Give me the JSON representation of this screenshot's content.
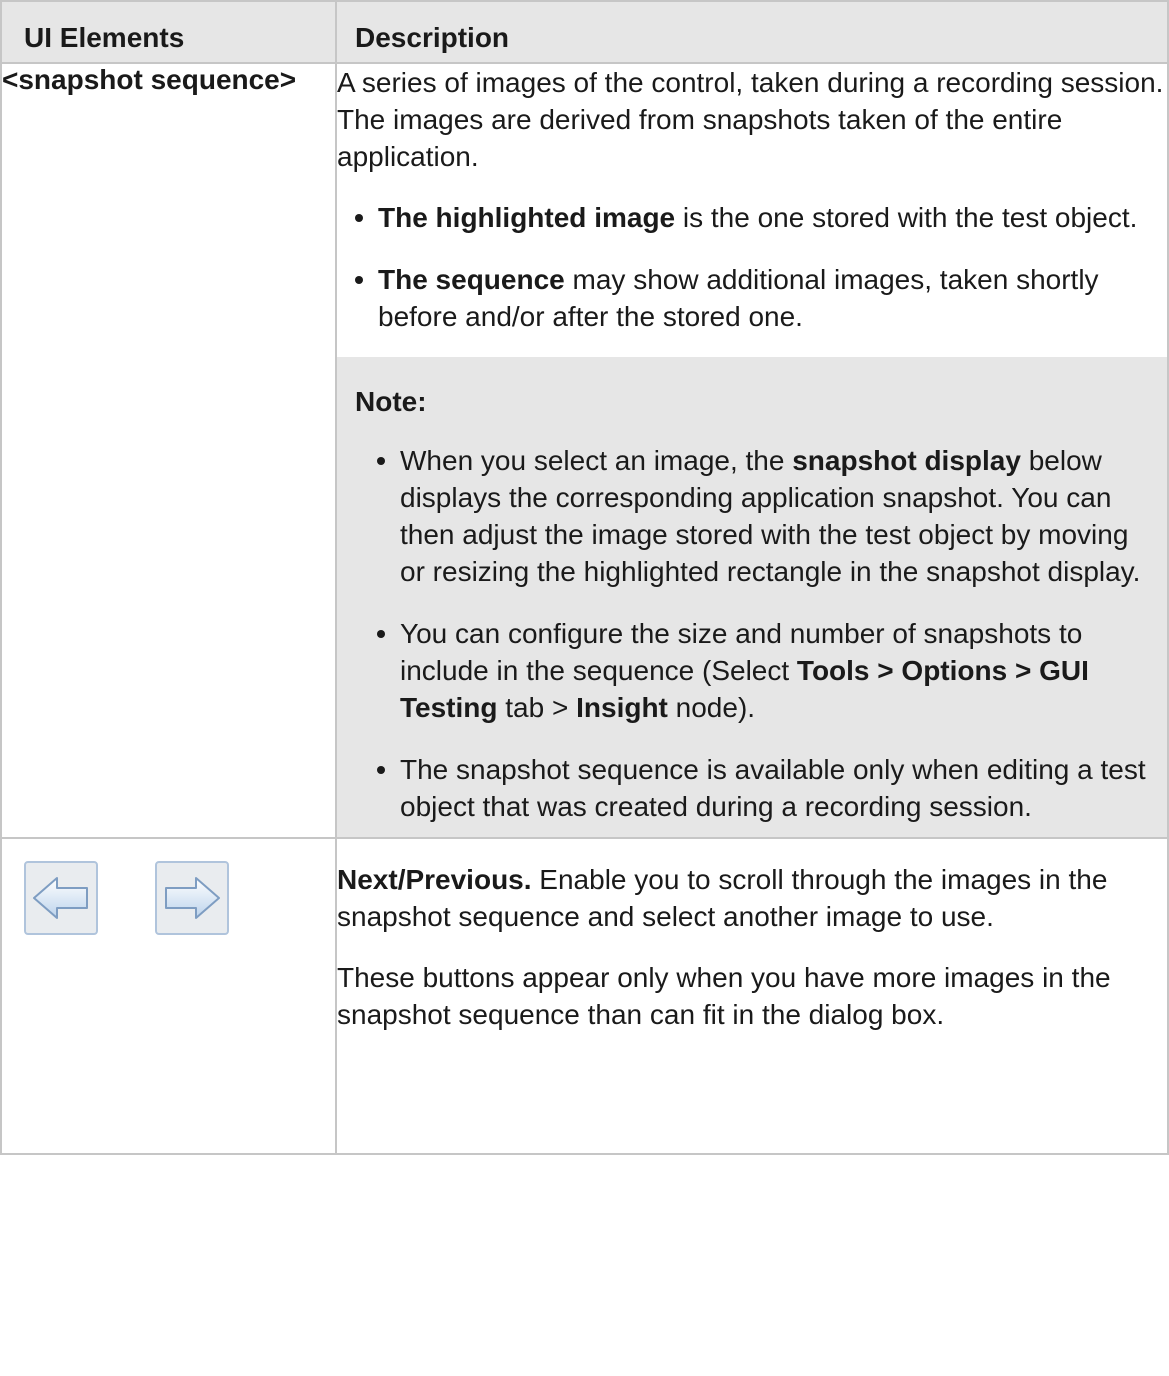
{
  "header": {
    "col1": "UI Elements",
    "col2": "Description"
  },
  "row1": {
    "element": "<snapshot sequence>",
    "intro": "A series of images of the control, taken during a recording session. The images are derived from snapshots taken of the entire application.",
    "bullets": [
      {
        "bold": "The highlighted image",
        "rest": " is the one stored with the test object."
      },
      {
        "bold": "The sequence",
        "rest": " may show additional images, taken shortly before and/or after the stored one."
      }
    ],
    "note": {
      "title": "Note:",
      "item1": {
        "before": "When you select an image, the ",
        "bold": "snapshot display",
        "after": " below displays the corresponding application snapshot. You can then adjust the image stored with the test object by moving or resizing the highlighted rectangle in the snapshot display."
      },
      "item2": {
        "before": "You can configure the size and number of snapshots to include in the sequence (Select ",
        "bold1": "Tools > Options > GUI Testing",
        "mid": " tab > ",
        "bold2": "Insight",
        "after": " node)."
      },
      "item3": "The snapshot sequence is available only when editing a test object that was created during a recording session."
    }
  },
  "row2": {
    "icons": [
      "left-arrow-icon",
      "right-arrow-icon"
    ],
    "p1_bold": "Next/Previous.",
    "p1_rest": " Enable you to scroll through the images in the snapshot sequence and select another image to use.",
    "p2": "These buttons appear only when you have more images in the snapshot sequence than can fit in the dialog box."
  }
}
